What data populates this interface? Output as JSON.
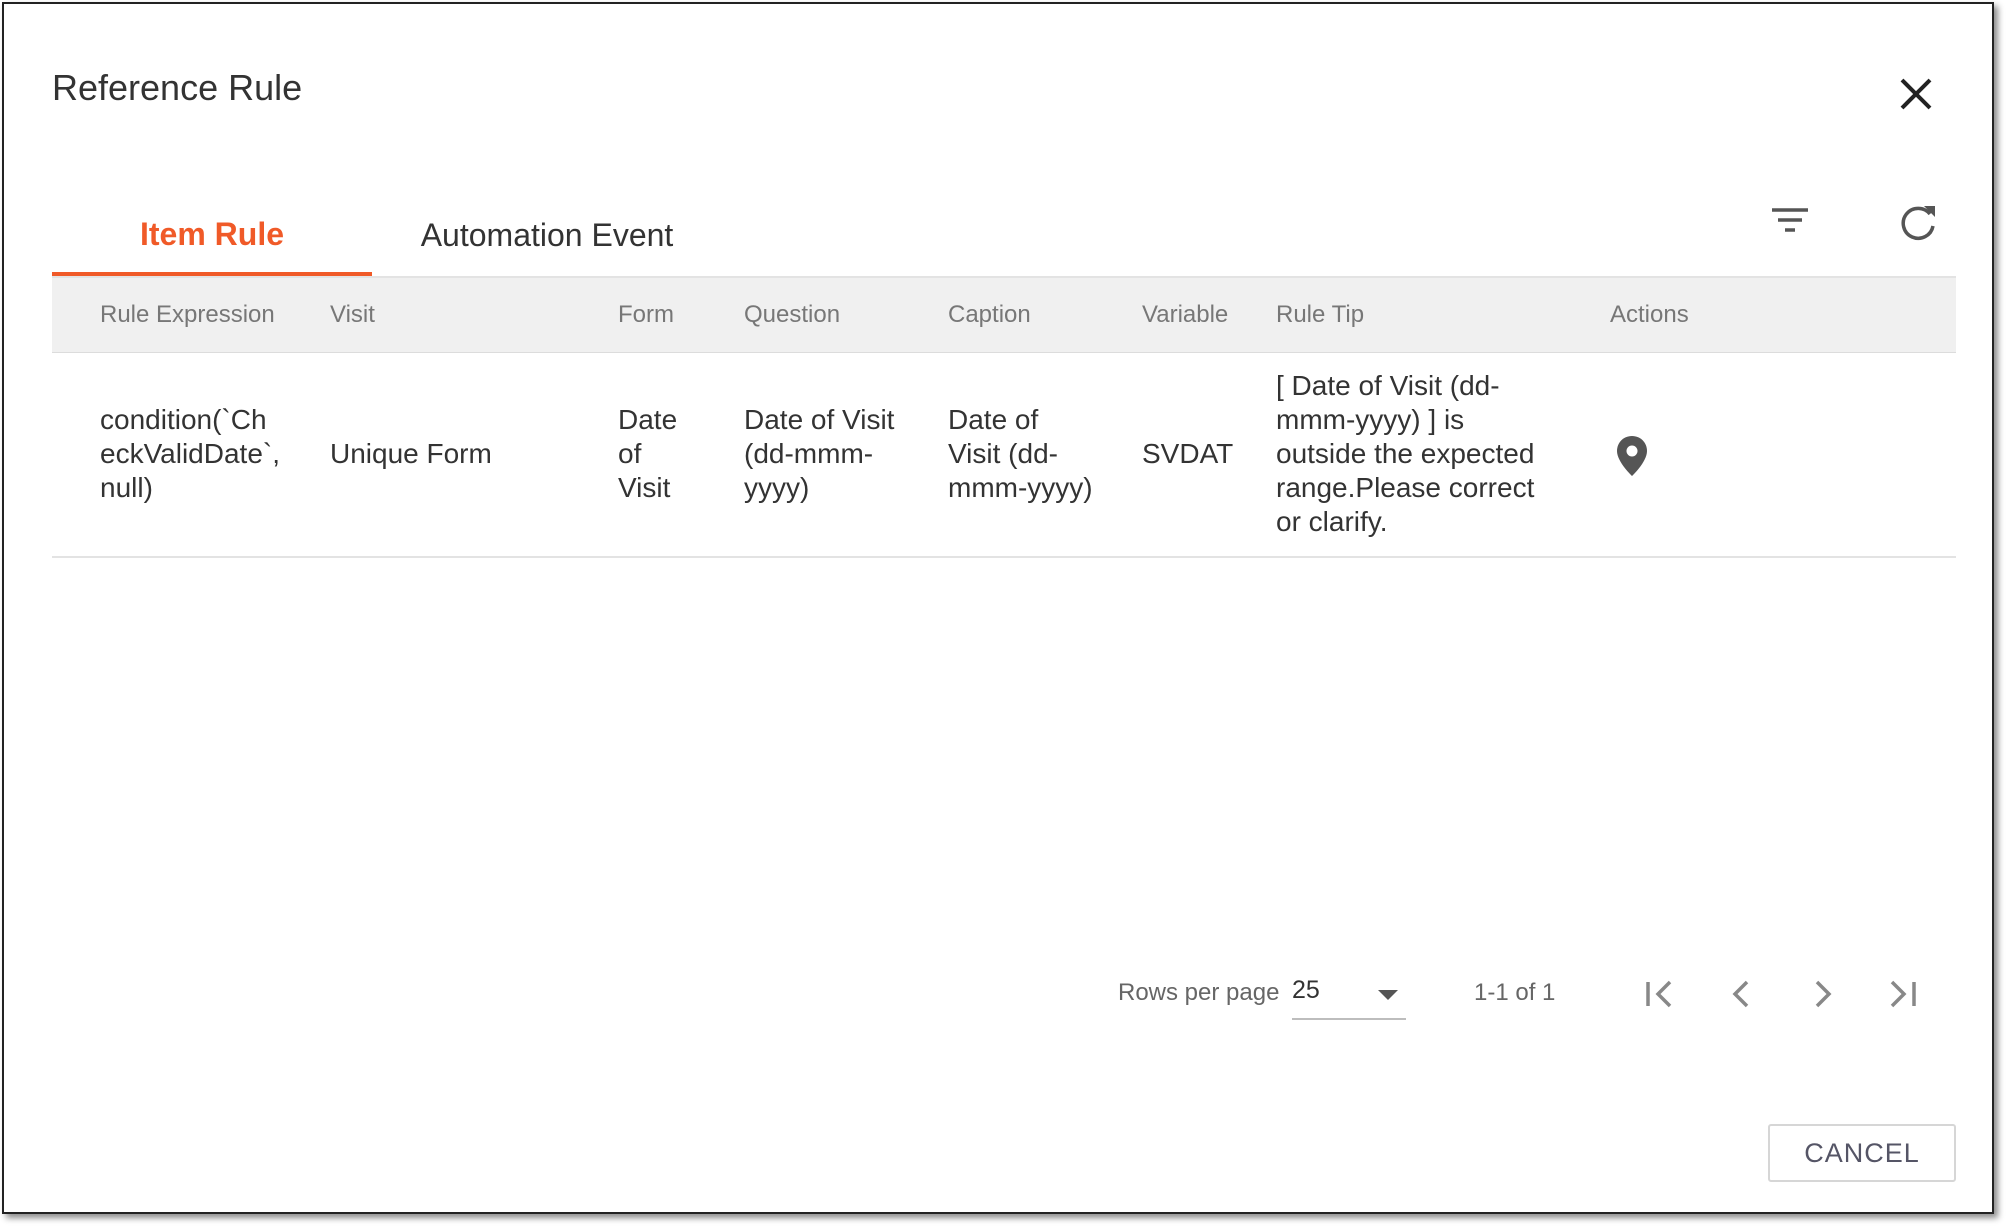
{
  "dialog": {
    "title": "Reference Rule"
  },
  "tabs": [
    {
      "label": "Item Rule",
      "active": true
    },
    {
      "label": "Automation Event",
      "active": false
    }
  ],
  "toolbar": {
    "filter_icon": "filter-icon",
    "refresh_icon": "refresh-icon"
  },
  "table": {
    "columns": [
      "Rule Expression",
      "Visit",
      "Form",
      "Question",
      "Caption",
      "Variable",
      "Rule Tip",
      "Actions"
    ],
    "rows": [
      {
        "rule_expression": "condition(`Ch\neckValidDate`,\nnull)",
        "visit": "Unique Form",
        "form": "Date\nof\nVisit",
        "question": "Date of Visit\n(dd-mmm-\nyyyy)",
        "caption": "Date of\nVisit (dd-\nmmm-yyyy)",
        "variable": "SVDAT",
        "rule_tip": "[ Date of Visit (dd-\nmmm-yyyy) ] is\noutside the expected\nrange.Please correct\nor clarify.",
        "action_icon": "location-pin-icon"
      }
    ]
  },
  "pagination": {
    "rows_per_page_label": "Rows per page",
    "rows_per_page_value": "25",
    "range_text": "1-1 of 1"
  },
  "footer": {
    "cancel_label": "CANCEL"
  },
  "colors": {
    "accent": "#f05a28",
    "header_bg": "#f0f0f0"
  }
}
